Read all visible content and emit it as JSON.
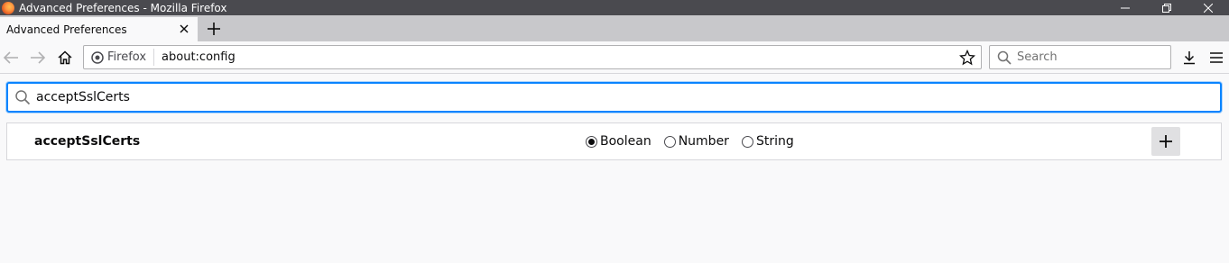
{
  "window": {
    "title": "Advanced Preferences - Mozilla Firefox",
    "buttons": [
      "minimize-icon",
      "restore-icon",
      "close-icon"
    ]
  },
  "tabs": [
    {
      "label": "Advanced Preferences",
      "active": true
    }
  ],
  "navbar": {
    "identity_label": "Firefox",
    "url": "about:config",
    "search_placeholder": "Search"
  },
  "about_config": {
    "filter_value": "acceptSslCerts",
    "new_pref": {
      "name": "acceptSslCerts",
      "types": [
        {
          "label": "Boolean",
          "checked": true
        },
        {
          "label": "Number",
          "checked": false
        },
        {
          "label": "String",
          "checked": false
        }
      ]
    }
  },
  "colors": {
    "titlebar": "#4a4a4f",
    "tabstrip": "#c8c8cb",
    "focus_accent": "#0a84ff",
    "page_bg": "#f9f9fa"
  }
}
